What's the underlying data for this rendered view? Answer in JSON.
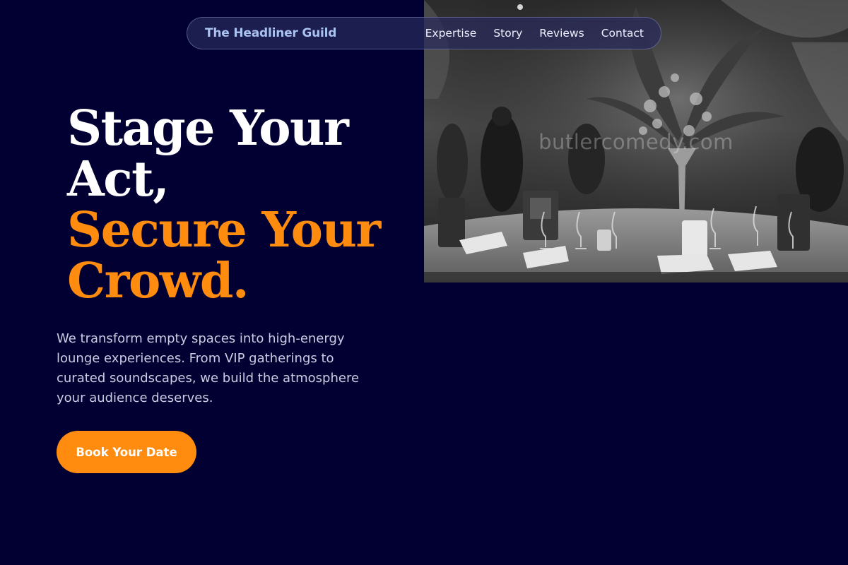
{
  "nav": {
    "brand": "The Headliner Guild",
    "links": [
      "Expertise",
      "Story",
      "Reviews",
      "Contact"
    ]
  },
  "hero": {
    "headline": {
      "line1": "Stage Your",
      "line2": "Act,",
      "line3": "Secure Your",
      "line4": "Crowd."
    },
    "description": "We transform empty spaces into high-energy lounge experiences. From VIP gatherings to curated soundscapes, we build the atmosphere your audience deserves.",
    "cta_label": "Book Your Date",
    "image_watermark": "butlercomedy.com"
  },
  "colors": {
    "background": "#020033",
    "accent": "#ff8c0f",
    "brand_text": "#a9c2f0"
  }
}
